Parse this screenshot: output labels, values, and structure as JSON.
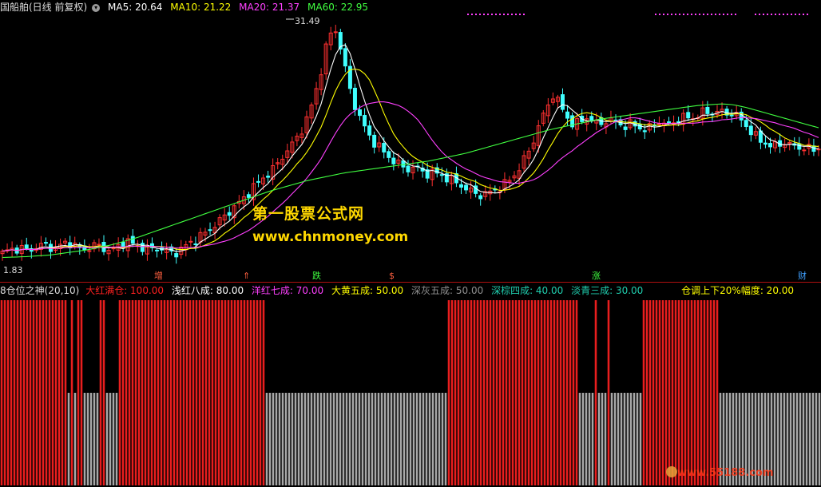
{
  "top_header": {
    "title": "国船舶(日线 前复权)",
    "ma5": "MA5: 20.64",
    "ma10": "MA10: 21.22",
    "ma20": "MA20: 21.37",
    "ma60": "MA60: 22.95",
    "colors": {
      "title": "#dcdcdc",
      "ma5": "#ffffff",
      "ma10": "#ffff00",
      "ma20": "#ff40ff",
      "ma60": "#40ff40"
    }
  },
  "price_labels": {
    "high": "31.49",
    "low": "1.83"
  },
  "bottom_header": {
    "name": "8仓位之神(20,10)",
    "items": [
      {
        "label": "大红满仓: 100.00",
        "color": "#ff2020"
      },
      {
        "label": "浅红八成: 80.00",
        "color": "#ffffff"
      },
      {
        "label": "洋红七成: 70.00",
        "color": "#ff40ff"
      },
      {
        "label": "大黄五成: 50.00",
        "color": "#ffff00"
      },
      {
        "label": "深灰五成: 50.00",
        "color": "#909090"
      },
      {
        "label": "深棕四成: 40.00",
        "color": "#20d0b0"
      },
      {
        "label": "淡青三成: 30.00",
        "color": "#20d0b0"
      }
    ],
    "extra": "仓调上下20%幅度: 20.00"
  },
  "events": [
    {
      "label": "增",
      "color": "#ff6040"
    },
    {
      "label": "⇑",
      "color": "#ff6040"
    },
    {
      "label": "跌",
      "color": "#40ff40"
    },
    {
      "label": "$",
      "color": "#ff6040"
    },
    {
      "label": "涨",
      "color": "#40ff40"
    },
    {
      "label": "财",
      "color": "#40a0ff"
    }
  ],
  "watermarks": {
    "cn": "第一股票公式网",
    "url": "www.chnmoney.com",
    "site": "www.55188.com"
  },
  "chart_data": [
    {
      "type": "candlestick",
      "series_names": [
        "MA5",
        "MA10",
        "MA20",
        "MA60"
      ],
      "series_colors": [
        "#ffffff",
        "#ffff00",
        "#ff40ff",
        "#40ff40"
      ],
      "up_color": "#ff3030",
      "down_color": "#40ffff",
      "high_label": 31.49,
      "low_label": 1.83,
      "close_path": [
        3.5,
        3.9,
        4.0,
        4.1,
        3.8,
        4.2,
        4.5,
        4.3,
        4.0,
        4.6,
        4.8,
        4.3,
        3.9,
        4.1,
        4.5,
        4.2,
        3.8,
        4.0,
        4.6,
        4.9,
        4.4,
        4.2,
        3.9,
        4.1,
        4.0,
        3.6,
        3.5,
        4.0,
        4.6,
        5.0,
        5.6,
        6.1,
        6.8,
        7.5,
        8.2,
        9.0,
        9.6,
        10.5,
        11.4,
        12.1,
        12.8,
        13.5,
        14.6,
        15.6,
        16.6,
        17.8,
        19.4,
        21.8,
        24.8,
        28.4,
        30.2,
        27.5,
        23.9,
        21.0,
        19.2,
        17.6,
        16.5,
        15.8,
        14.9,
        14.3,
        13.8,
        13.3,
        13.6,
        13.2,
        12.8,
        13.0,
        12.7,
        12.3,
        12.0,
        11.5,
        11.0,
        10.6,
        10.3,
        10.5,
        10.8,
        11.2,
        11.8,
        12.5,
        13.6,
        15.0,
        16.6,
        18.8,
        20.5,
        22.1,
        21.0,
        19.5,
        18.6,
        18.8,
        19.5,
        19.0,
        18.5,
        19.1,
        19.0,
        18.6,
        18.4,
        18.7,
        18.2,
        17.9,
        18.5,
        19.0,
        18.4,
        18.8,
        19.2,
        19.5,
        19.3,
        19.8,
        20.1,
        19.9,
        20.2,
        19.8,
        20.0,
        19.4,
        18.5,
        17.6,
        16.8,
        16.4,
        16.0,
        16.2,
        16.5,
        16.1,
        15.8,
        16.0,
        15.5,
        15.8
      ],
      "ma60_path": [
        3.0,
        3.05,
        3.1,
        3.2,
        3.3,
        3.5,
        3.7,
        3.9,
        4.2,
        4.5,
        4.9,
        5.3,
        5.8,
        6.3,
        6.8,
        7.3,
        7.8,
        8.3,
        8.8,
        9.3,
        9.8,
        10.3,
        10.8,
        11.2,
        11.6,
        12.0,
        12.3,
        12.6,
        12.9,
        13.1,
        13.3,
        13.5,
        13.7,
        13.9,
        14.1,
        14.3,
        14.6,
        14.9,
        15.2,
        15.6,
        16.0,
        16.4,
        16.8,
        17.2,
        17.6,
        18.0,
        18.3,
        18.6,
        18.9,
        19.2,
        19.4,
        19.6,
        19.8,
        20.0,
        20.2,
        20.4,
        20.6,
        20.8,
        20.9,
        21.0,
        20.9,
        20.6,
        20.2,
        19.8,
        19.4,
        19.0,
        18.6,
        18.2
      ],
      "position_bars": [
        100,
        100,
        100,
        100,
        100,
        100,
        100,
        100,
        100,
        100,
        100,
        100,
        100,
        100,
        100,
        100,
        100,
        100,
        100,
        100,
        100,
        50,
        100,
        50,
        100,
        100,
        50,
        50,
        50,
        50,
        50,
        100,
        100,
        50,
        50,
        50,
        50,
        100,
        100,
        100,
        100,
        100,
        100,
        100,
        100,
        100,
        100,
        100,
        100,
        100,
        100,
        100,
        100,
        100,
        100,
        100,
        100,
        100,
        100,
        100,
        100,
        100,
        100,
        100,
        100,
        100,
        100,
        100,
        100,
        100,
        100,
        100,
        100,
        100,
        100,
        100,
        100,
        100,
        100,
        100,
        100,
        100,
        100,
        50,
        50,
        50,
        50,
        50,
        50,
        50,
        50,
        50,
        50,
        50,
        50,
        50,
        50,
        50,
        50,
        50,
        50,
        50,
        50,
        50,
        50,
        50,
        50,
        50,
        50,
        50,
        50,
        50,
        50,
        50,
        50,
        50,
        50,
        50,
        50,
        50,
        50,
        50,
        50,
        50,
        50,
        50,
        50,
        50,
        50,
        50,
        50,
        50,
        50,
        50,
        50,
        50,
        50,
        50,
        50,
        50,
        100,
        100,
        100,
        100,
        100,
        100,
        100,
        100,
        100,
        100,
        100,
        100,
        100,
        100,
        100,
        100,
        100,
        100,
        100,
        100,
        100,
        100,
        100,
        100,
        100,
        100,
        100,
        100,
        100,
        100,
        100,
        100,
        100,
        100,
        100,
        100,
        100,
        100,
        100,
        100,
        100,
        50,
        50,
        50,
        50,
        50,
        100,
        50,
        50,
        50,
        100,
        50,
        50,
        50,
        50,
        50,
        50,
        50,
        50,
        50,
        50,
        100,
        100,
        100,
        100,
        100,
        100,
        100,
        100,
        100,
        100,
        100,
        100,
        100,
        100,
        100,
        100,
        100,
        100,
        100,
        100,
        100,
        100,
        100,
        100,
        50,
        50,
        50,
        50,
        50,
        50,
        50,
        50,
        50,
        50,
        50,
        50,
        50,
        50,
        50,
        50,
        50,
        50,
        50,
        50,
        50,
        50,
        50,
        50,
        50,
        50,
        50,
        50,
        50,
        50,
        50,
        50
      ]
    }
  ]
}
